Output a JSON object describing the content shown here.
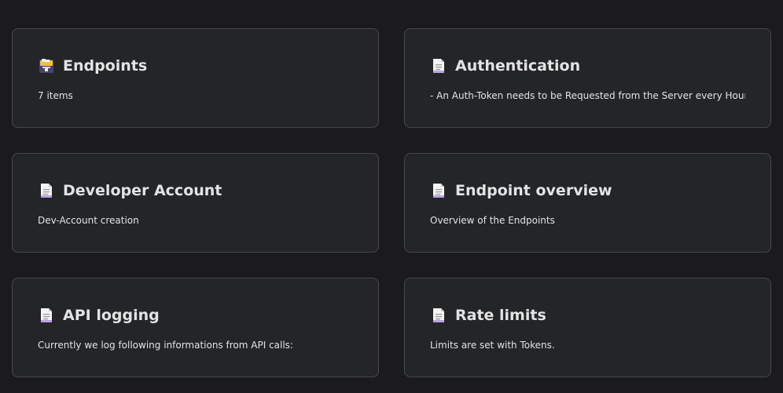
{
  "cards": [
    {
      "title": "Endpoints",
      "description": "7 items",
      "icon": "file-box-icon"
    },
    {
      "title": "Authentication",
      "description": "- An Auth-Token needs to be Requested from the Server every Hour.",
      "icon": "document-icon"
    },
    {
      "title": "Developer Account",
      "description": "Dev-Account creation",
      "icon": "document-icon"
    },
    {
      "title": "Endpoint overview",
      "description": "Overview of the Endpoints",
      "icon": "document-icon"
    },
    {
      "title": "API logging",
      "description": "Currently we log following informations from API calls:",
      "icon": "document-icon"
    },
    {
      "title": "Rate limits",
      "description": "Limits are set with Tokens.",
      "icon": "document-icon"
    }
  ],
  "colors": {
    "background": "#1b1b1d",
    "card": "#242526",
    "border": "#444950",
    "text": "#e3e3e3"
  }
}
